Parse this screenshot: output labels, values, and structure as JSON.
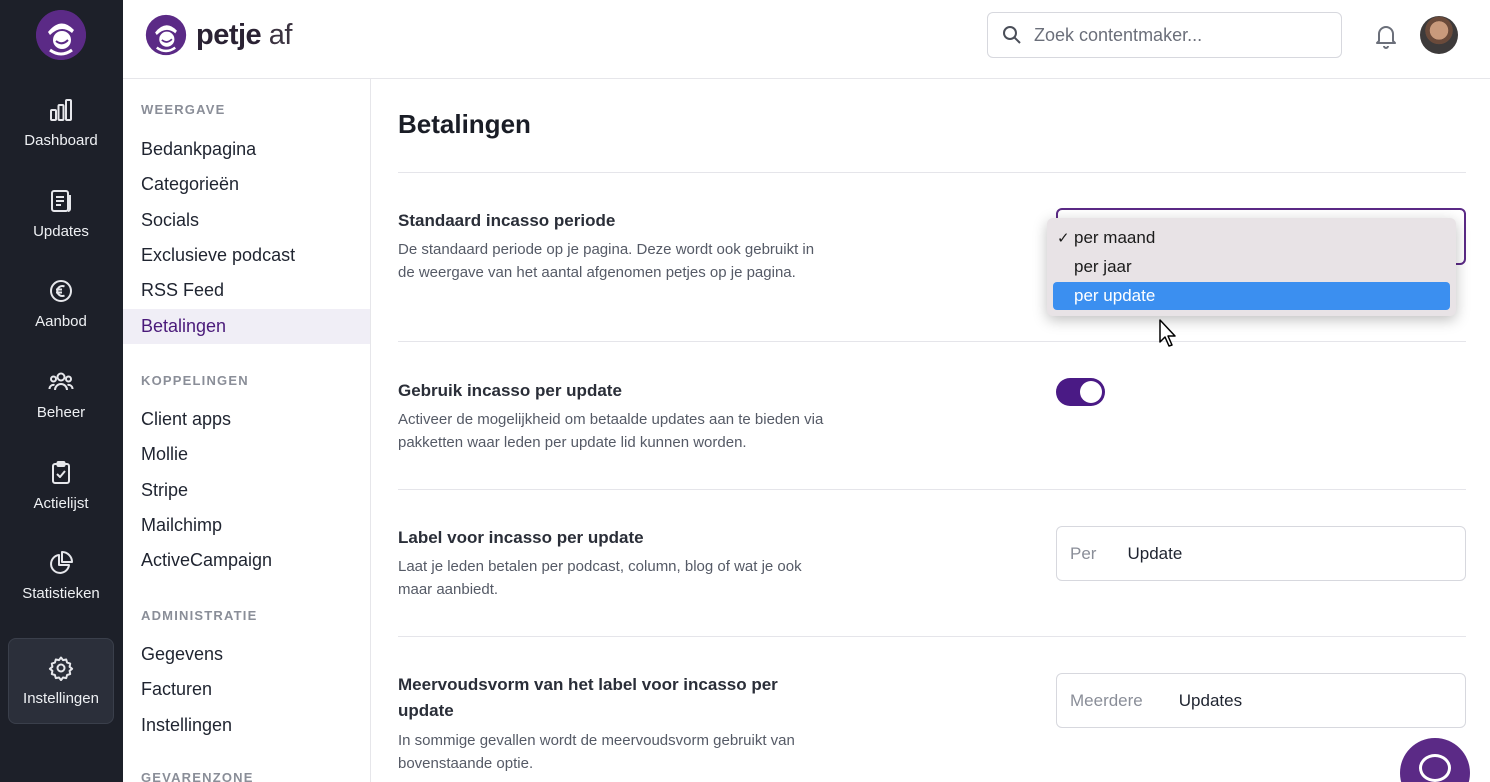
{
  "brand": {
    "name_bold": "petje",
    "name_light": " af"
  },
  "rail": {
    "items": [
      {
        "label": "Dashboard",
        "icon": "bar-chart-icon"
      },
      {
        "label": "Updates",
        "icon": "newspaper-icon"
      },
      {
        "label": "Aanbod",
        "icon": "euro-icon"
      },
      {
        "label": "Beheer",
        "icon": "users-icon"
      },
      {
        "label": "Actielijst",
        "icon": "clipboard-check-icon"
      },
      {
        "label": "Statistieken",
        "icon": "pie-chart-icon"
      },
      {
        "label": "Instellingen",
        "icon": "gear-icon",
        "active": true
      }
    ]
  },
  "search": {
    "placeholder": "Zoek contentmaker..."
  },
  "subnav": {
    "sections": [
      {
        "heading": "WEERGAVE",
        "items": [
          "Bedankpagina",
          "Categorieën",
          "Socials",
          "Exclusieve podcast",
          "RSS Feed",
          "Betalingen"
        ]
      },
      {
        "heading": "KOPPELINGEN",
        "items": [
          "Client apps",
          "Mollie",
          "Stripe",
          "Mailchimp",
          "ActiveCampaign"
        ]
      },
      {
        "heading": "ADMINISTRATIE",
        "items": [
          "Gegevens",
          "Facturen",
          "Instellingen"
        ]
      },
      {
        "heading": "GEVARENZONE",
        "items": []
      }
    ],
    "active": "Betalingen"
  },
  "main": {
    "title": "Betalingen",
    "period": {
      "title": "Standaard incasso periode",
      "description": "De standaard periode op je pagina. Deze wordt ook gebruikt in de weergave van het aantal afgenomen petjes op je pagina.",
      "options": [
        "per maand",
        "per jaar",
        "per update"
      ],
      "selected": "per maand",
      "highlighted": "per update",
      "check": "✓"
    },
    "per_update": {
      "title": "Gebruik incasso per update",
      "description": "Activeer de mogelijkheid om betaalde updates aan te bieden via pakketten waar leden per update lid kunnen worden.",
      "enabled": true
    },
    "label": {
      "title": "Label voor incasso per update",
      "description": "Laat je leden betalen per podcast, column, blog of wat je ook maar aanbiedt.",
      "prefix": "Per",
      "value": "Update"
    },
    "plural": {
      "title": "Meervoudsvorm van het label voor incasso per update",
      "description": "In sommige gevallen wordt de meervoudsvorm gebruikt van bovenstaande optie.",
      "prefix": "Meerdere",
      "value": "Updates"
    }
  },
  "colors": {
    "accent": "#5b2a86",
    "toggle": "#4a1a85",
    "highlight": "#3b8ff0",
    "rail": "#1d2029"
  }
}
